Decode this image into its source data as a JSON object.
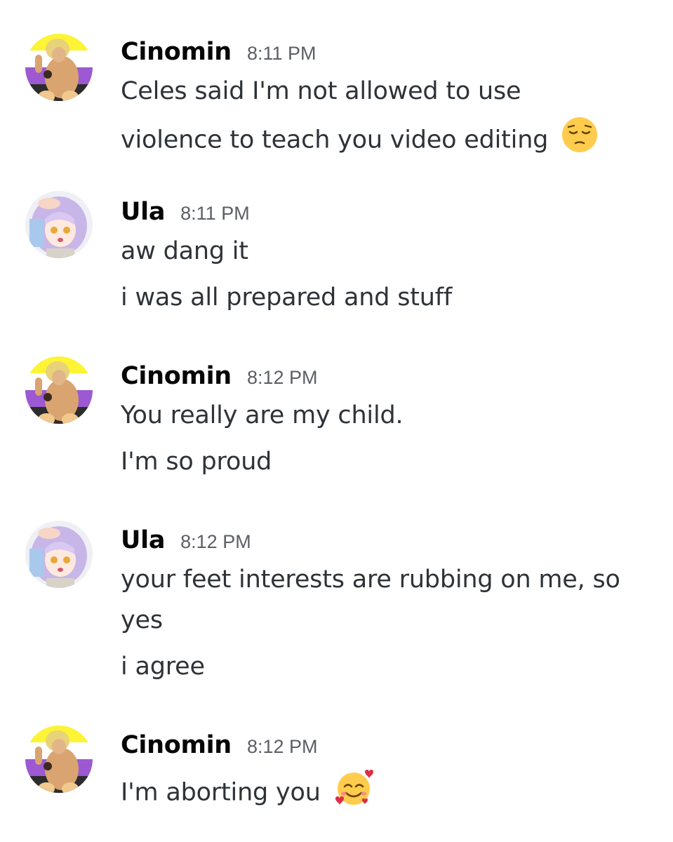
{
  "messages": [
    {
      "author": "Cinomin",
      "time": "8:11 PM",
      "avatar_icon": "cinomin-avatar-icon",
      "lines": [
        "Celes said I'm not allowed to use",
        "violence to teach you video editing"
      ],
      "trailing_emoji": "pensive-face-emoji"
    },
    {
      "author": "Ula",
      "time": "8:11 PM",
      "avatar_icon": "ula-avatar-icon",
      "lines": [
        "aw dang it",
        "i was all prepared and stuff"
      ]
    },
    {
      "author": "Cinomin",
      "time": "8:12 PM",
      "avatar_icon": "cinomin-avatar-icon",
      "lines": [
        "You really are my child.",
        "I'm so proud"
      ]
    },
    {
      "author": "Ula",
      "time": "8:12 PM",
      "avatar_icon": "ula-avatar-icon",
      "lines": [
        "your feet interests are rubbing on me, so",
        "yes",
        "i agree"
      ]
    },
    {
      "author": "Cinomin",
      "time": "8:12 PM",
      "avatar_icon": "cinomin-avatar-icon",
      "lines": [
        "I'm aborting you"
      ],
      "trailing_emoji": "smiling-face-with-hearts-emoji"
    }
  ],
  "colors": {
    "username": "#060607",
    "timestamp": "#5c5e66",
    "message_text": "#2e3338",
    "background": "#ffffff",
    "flag_yellow": "#fcf434",
    "flag_white": "#ffffff",
    "flag_purple": "#9c59d1",
    "flag_black": "#2c2c2c"
  }
}
